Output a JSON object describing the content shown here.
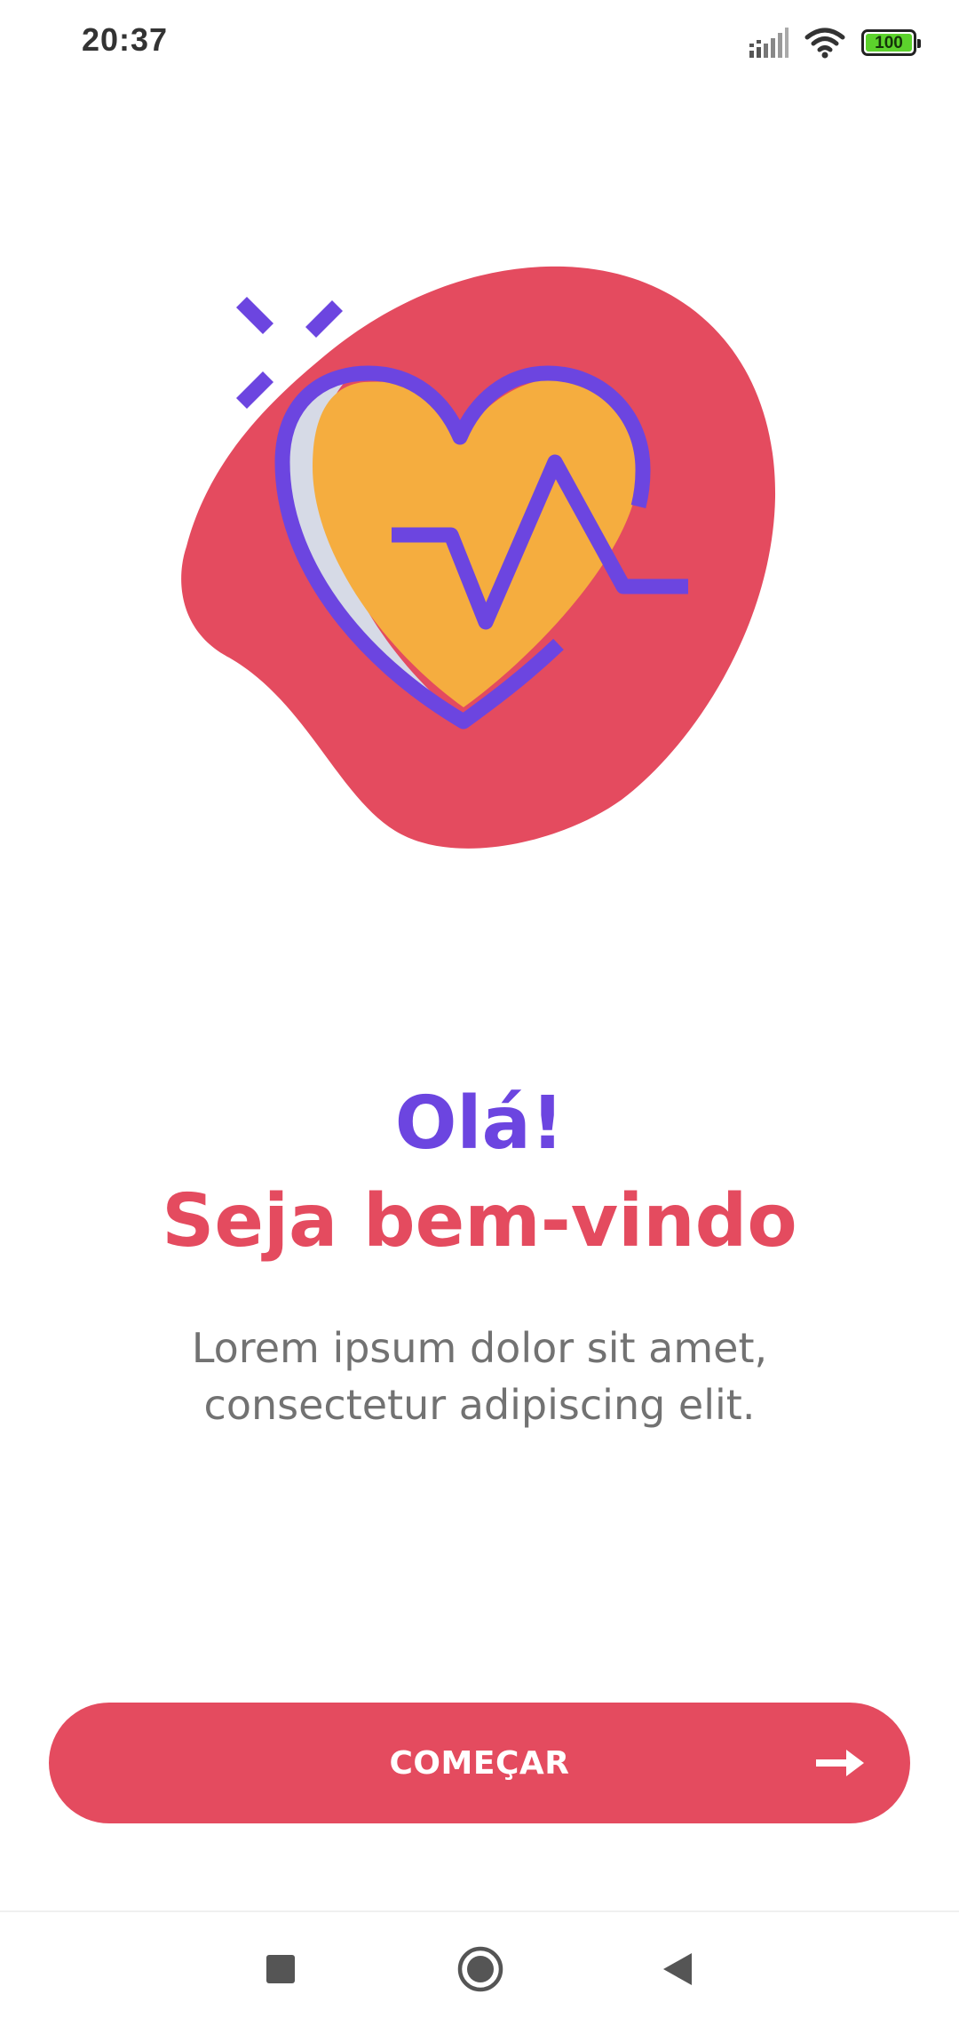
{
  "status_bar": {
    "time": "20:37",
    "battery_level": "100",
    "icons": [
      "signal-icon",
      "wifi-icon",
      "battery-icon"
    ]
  },
  "illustration": {
    "icon": "heart-pulse-icon",
    "colors": {
      "blob": "#e44b5f",
      "heart_fill": "#f5ad3f",
      "outline": "#6c45e0",
      "shadow": "#d6dae6"
    }
  },
  "content": {
    "greeting": "Olá!",
    "welcome": "Seja bem-vindo",
    "description": "Lorem ipsum dolor sit amet, consectetur adipiscing elit."
  },
  "button": {
    "label": "COMEÇAR",
    "icon": "arrow-right-icon",
    "color": "#e44b5f"
  },
  "navigation": {
    "recents_icon": "square-icon",
    "home_icon": "circle-icon",
    "back_icon": "triangle-back-icon"
  }
}
